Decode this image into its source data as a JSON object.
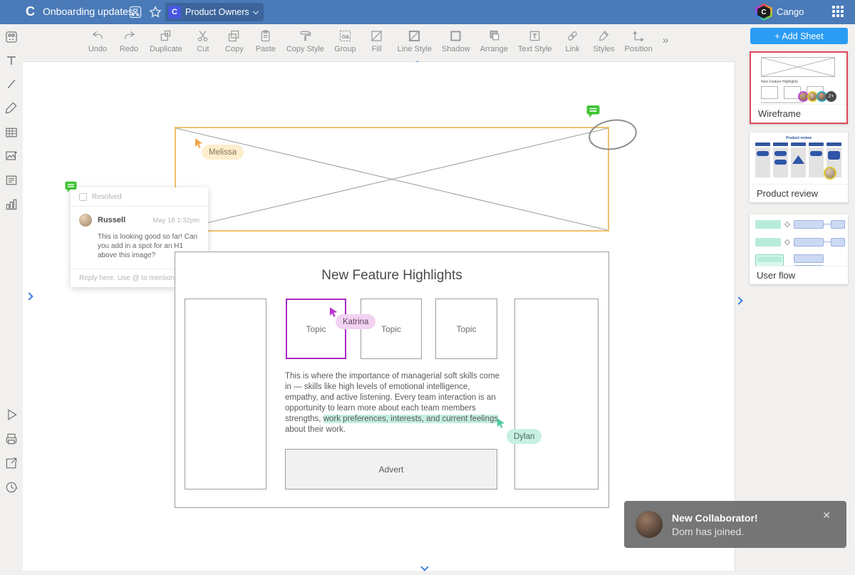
{
  "header": {
    "logo_letter": "C",
    "title": "Onboarding updates",
    "team_chip": {
      "icon_letter": "C",
      "label": "Product Owners"
    },
    "user": {
      "name": "Cango",
      "avatar_letter": "C"
    }
  },
  "toolbar": {
    "items": [
      "Undo",
      "Redo",
      "Duplicate",
      "Cut",
      "Copy",
      "Paste",
      "Copy Style",
      "Group",
      "Fill",
      "Line Style",
      "Shadow",
      "Arrange",
      "Text Style",
      "Link",
      "Styles",
      "Position"
    ],
    "overflow": "»"
  },
  "canvas": {
    "comment": {
      "resolved_label": "Resolved",
      "author": "Russell",
      "timestamp": "May 18 1:32pm",
      "body": "This is looking good so far! Can you add in a spot for an H1 above this image?",
      "reply_placeholder": "Reply here. Use @ to mention"
    },
    "cursors": [
      {
        "name": "Melissa",
        "color": "#f0a84f"
      },
      {
        "name": "Katrina",
        "color": "#b935d0"
      },
      {
        "name": "Dylan",
        "color": "#4cc9a0"
      }
    ],
    "wireframe": {
      "heading": "New Feature Highlights",
      "topics": [
        "Topic",
        "Topic",
        "Topic"
      ],
      "paragraph": {
        "before": "This is where the importance of managerial soft skills come in — skills like high levels of emotional intelligence, empathy, and active listening. Every team interaction is an opportunity to learn more about each team members strengths, ",
        "highlight": "work preferences, interests, and current feelings",
        "after": " about their work."
      },
      "advert_label": "Advert"
    }
  },
  "panel": {
    "add_sheet_label": "+ Add Sheet",
    "sheets": [
      {
        "name": "Wireframe",
        "selected": true,
        "thumb_heading": "New Feature Highlights",
        "badge": "2+"
      },
      {
        "name": "Product review",
        "selected": false,
        "thumb_title": "Product review"
      },
      {
        "name": "User flow",
        "selected": false
      }
    ]
  },
  "toast": {
    "title": "New Collaborator!",
    "message": "Dom has joined.",
    "close": "✕"
  },
  "colors": {
    "header_bg": "#4a7ab8",
    "accent_blue": "#3d7de0",
    "add_sheet_blue": "#2b9cf4",
    "selected_sheet_red": "#e0485a",
    "selection_orange": "#f0c06e",
    "selection_purple": "#a82bc5",
    "highlight_teal": "#c4efdf",
    "comment_green": "#3fc433"
  }
}
